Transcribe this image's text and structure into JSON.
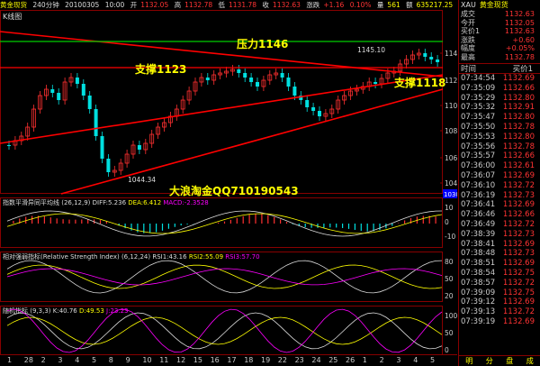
{
  "top_bar": {
    "name": "黄金现货",
    "period": "240分钟",
    "date": "20100305",
    "time": "10:00",
    "open_label": "开",
    "open": "1132.05",
    "high_label": "高",
    "high": "1132.78",
    "low_label": "低",
    "low": "1131.78",
    "close_label": "收",
    "close": "1132.63",
    "change_label": "涨跌",
    "change": "+1.16",
    "change_pct": "0.10%",
    "volume_label": "量",
    "volume": "561",
    "amount_label": "额",
    "amount": "635217.25"
  },
  "main_chart": {
    "title": "K线图",
    "annotations": {
      "resistance": "压力1146",
      "support_1": "支撑1123",
      "support_2": "支撑1118",
      "watermark": "大浪淘金QQ710190543",
      "high_mark": "1145.10",
      "low_mark": "1044.34"
    },
    "y_ticks": [
      "1140",
      "1120",
      "1100",
      "1080",
      "1060",
      "1040"
    ],
    "price_box": "1030.93",
    "colors": {
      "up": "#ff3030",
      "down": "#00e0e0",
      "resistance": "#00cc00",
      "trend": "#ff0000"
    }
  },
  "macd_pane": {
    "name": "指数平滑异同平均线",
    "params": "(26,12,9)",
    "diff": "DIFF:5.236",
    "dea": "DEA:6.412",
    "macd": "MACD:-2.3528",
    "y_ticks": [
      "10",
      "0",
      "-10"
    ]
  },
  "rsi_pane": {
    "name": "相对强弱指标(Relative Strength Index)",
    "params": "(6,12,24)",
    "rsi1": "RSI1:43.16",
    "rsi2": "RSI2:55.09",
    "rsi3": "RSI3:57.70",
    "y_ticks": [
      "80",
      "50",
      "20"
    ]
  },
  "kdj_pane": {
    "name": "随机指标",
    "params": "(9,3,3)",
    "k": "K:40.76",
    "d": "D:49.53",
    "j": "J:23.23",
    "y_ticks": [
      "100",
      "50",
      "0"
    ]
  },
  "x_axis": [
    "1",
    "28",
    "2",
    "3",
    "4",
    "5",
    "8",
    "9",
    "10",
    "11",
    "12",
    "15",
    "16",
    "17",
    "18",
    "19",
    "22",
    "23",
    "24",
    "25",
    "26",
    "1",
    "2",
    "3",
    "4",
    "5"
  ],
  "right_panel": {
    "symbol": "XAU",
    "name": "黄金现货",
    "quote": [
      {
        "k": "成交",
        "v": "1132.63"
      },
      {
        "k": "今开",
        "v": "1132.05"
      },
      {
        "k": "买价1",
        "v": "1132.63"
      },
      {
        "k": "涨跌",
        "v": "+0.60"
      },
      {
        "k": "幅度",
        "v": "+0.05%"
      },
      {
        "k": "最高",
        "v": "1132.78"
      }
    ],
    "table_headers": [
      "时间",
      "买价1"
    ],
    "ticks": [
      {
        "t": "07:34:54",
        "p": "1132.69"
      },
      {
        "t": "07:35:09",
        "p": "1132.66"
      },
      {
        "t": "07:35:29",
        "p": "1132.80"
      },
      {
        "t": "07:35:32",
        "p": "1132.91"
      },
      {
        "t": "07:35:47",
        "p": "1132.80"
      },
      {
        "t": "07:35:50",
        "p": "1132.78"
      },
      {
        "t": "07:35:53",
        "p": "1132.80"
      },
      {
        "t": "07:35:56",
        "p": "1132.78"
      },
      {
        "t": "07:35:57",
        "p": "1132.66"
      },
      {
        "t": "07:36:00",
        "p": "1132.61"
      },
      {
        "t": "07:36:07",
        "p": "1132.69"
      },
      {
        "t": "07:36:10",
        "p": "1132.72"
      },
      {
        "t": "07:36:19",
        "p": "1132.73"
      },
      {
        "t": "07:36:41",
        "p": "1132.69"
      },
      {
        "t": "07:36:46",
        "p": "1132.66"
      },
      {
        "t": "07:36:49",
        "p": "1132.72"
      },
      {
        "t": "07:38:39",
        "p": "1132.73"
      },
      {
        "t": "07:38:41",
        "p": "1132.69"
      },
      {
        "t": "07:38:48",
        "p": "1132.73"
      },
      {
        "t": "07:38:51",
        "p": "1132.69"
      },
      {
        "t": "07:38:54",
        "p": "1132.75"
      },
      {
        "t": "07:38:57",
        "p": "1132.72"
      },
      {
        "t": "07:39:09",
        "p": "1132.75"
      },
      {
        "t": "07:39:12",
        "p": "1132.69"
      },
      {
        "t": "07:39:13",
        "p": "1132.72"
      },
      {
        "t": "07:39:19",
        "p": "1132.69"
      }
    ],
    "bottom_tabs": [
      "明",
      "分",
      "盘",
      "成"
    ]
  }
}
